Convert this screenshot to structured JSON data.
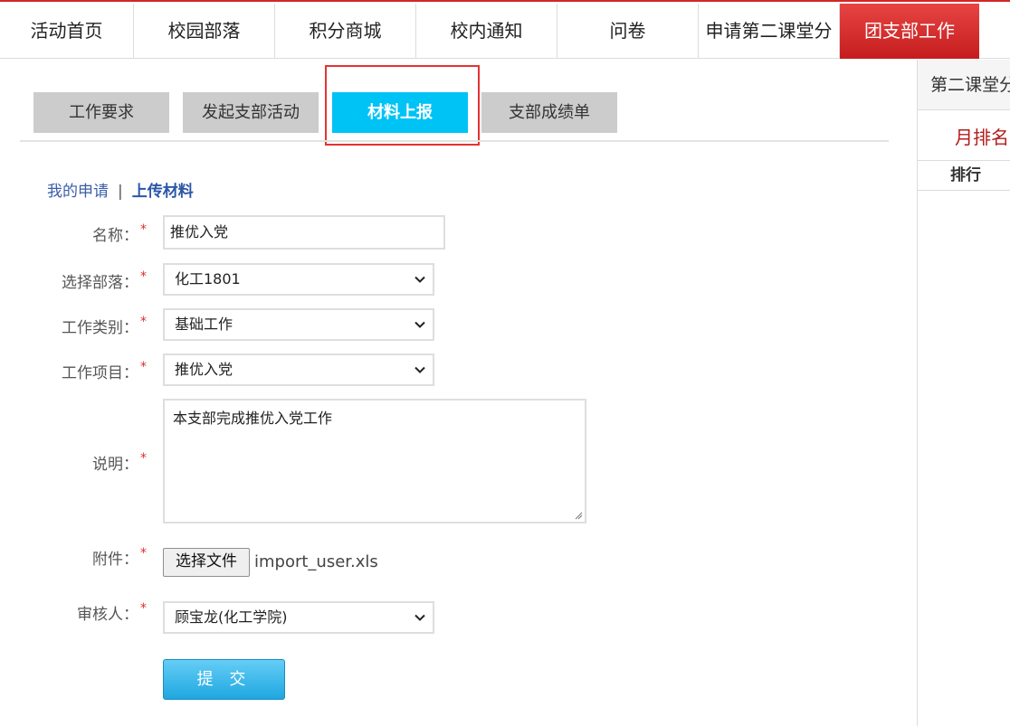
{
  "nav": {
    "items": [
      "活动首页",
      "校园部落",
      "积分商城",
      "校内通知",
      "问卷",
      "申请第二课堂分",
      "团支部工作"
    ],
    "active_index": 6
  },
  "tabs": {
    "items": [
      "工作要求",
      "发起支部活动",
      "材料上报",
      "支部成绩单"
    ],
    "active_index": 2
  },
  "breadcrumb": {
    "link": "我的申请",
    "separator": "|",
    "current": "上传材料"
  },
  "form": {
    "name_label": "名称：",
    "name_value": "推优入党",
    "tribe_label": "选择部落：",
    "tribe_value": "化工1801",
    "category_label": "工作类别：",
    "category_value": "基础工作",
    "project_label": "工作项目：",
    "project_value": "推优入党",
    "desc_label": "说明：",
    "desc_value": "本支部完成推优入党工作",
    "attach_label": "附件：",
    "file_button": "选择文件",
    "file_name": "import_user.xls",
    "reviewer_label": "审核人：",
    "reviewer_value": "顾宝龙(化工学院)",
    "required_mark": "*",
    "submit_label": "提 交"
  },
  "right_panel": {
    "title": "第二课堂分",
    "subtitle": "月排名",
    "column": "排行"
  },
  "colors": {
    "nav_active": "#d32727",
    "tab_active": "#00c3f5",
    "highlight_box": "#e53333",
    "required": "#e02b2b",
    "link": "#3a5ea8"
  }
}
